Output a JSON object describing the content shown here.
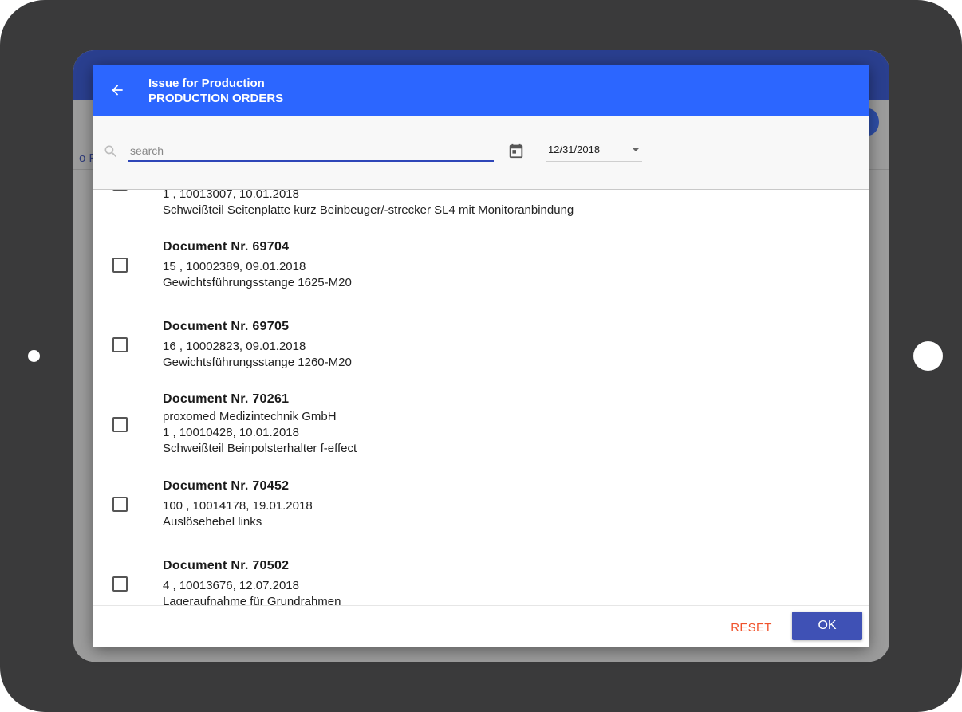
{
  "header": {
    "title": "Issue for Production",
    "subtitle": "PRODUCTION ORDERS"
  },
  "background": {
    "partial_text": "o F"
  },
  "filter": {
    "search_placeholder": "search",
    "search_value": "",
    "date_value": "12/31/2018"
  },
  "documents": [
    {
      "title": "",
      "lines": [
        "1 , 10013007, 10.01.2018",
        "Schweißteil Seitenplatte kurz Beinbeuger/-strecker SL4 mit Monitoranbindung"
      ],
      "checked": false
    },
    {
      "title": "Document Nr. 69704",
      "lines": [
        "15 , 10002389, 09.01.2018",
        "Gewichtsführungsstange 1625-M20"
      ],
      "checked": false
    },
    {
      "title": "Document Nr. 69705",
      "lines": [
        "16 , 10002823, 09.01.2018",
        "Gewichtsführungsstange 1260-M20"
      ],
      "checked": false
    },
    {
      "title": "Document Nr. 70261",
      "lines": [
        "proxomed Medizintechnik GmbH",
        "1 , 10010428, 10.01.2018",
        "Schweißteil Beinpolsterhalter f-effect"
      ],
      "checked": false
    },
    {
      "title": "Document Nr. 70452",
      "lines": [
        "100 , 10014178, 19.01.2018",
        "Auslösehebel links"
      ],
      "checked": false
    },
    {
      "title": "Document Nr. 70502",
      "lines": [
        "4 , 10013676, 12.07.2018",
        "Lageraufnahme für Grundrahmen"
      ],
      "checked": false
    }
  ],
  "footer": {
    "reset_label": "RESET",
    "ok_label": "OK"
  },
  "colors": {
    "header_blue": "#2c66ff",
    "ok_button": "#3f51b5",
    "reset_text": "#f0522b"
  }
}
